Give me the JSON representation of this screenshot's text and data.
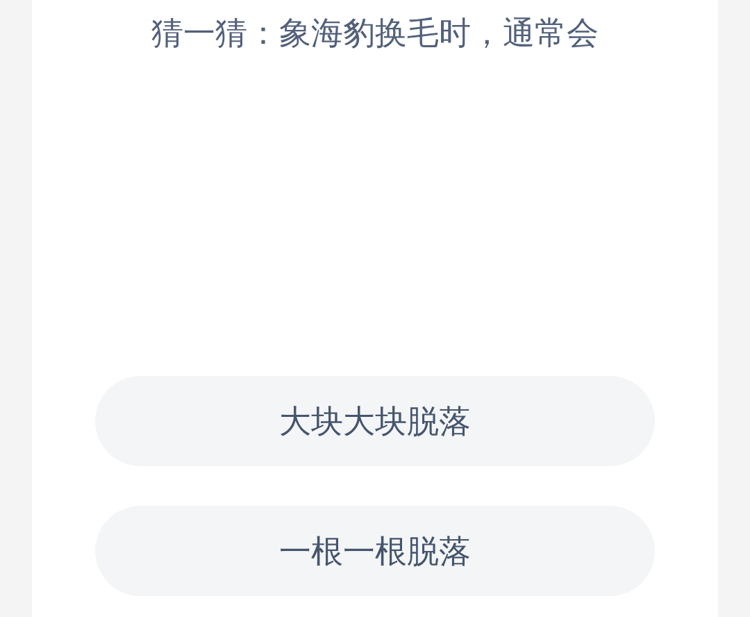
{
  "question": "猜一猜：象海豹换毛时，通常会",
  "options": [
    {
      "label": "大块大块脱落"
    },
    {
      "label": "一根一根脱落"
    }
  ]
}
